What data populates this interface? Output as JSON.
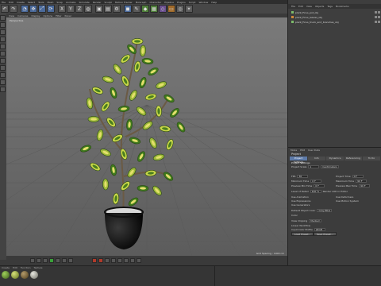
{
  "menubar": {
    "items": [
      "File",
      "Edit",
      "Create",
      "Select",
      "Tools",
      "Mesh",
      "Snap",
      "Animate",
      "Simulate",
      "Render",
      "Sculpt",
      "Motion Tracker",
      "MoGraph",
      "Character",
      "Pipeline",
      "Plugins",
      "Script",
      "Window",
      "Help"
    ]
  },
  "toolbar": {
    "icons": [
      "undo-icon",
      "redo-icon",
      "live-selection-icon",
      "move-icon",
      "scale-icon",
      "rotate-icon",
      "x-axis-icon",
      "y-axis-icon",
      "z-axis-icon",
      "world-coords-icon",
      "render-view-icon",
      "render-pv-icon",
      "render-settings-icon",
      "cube-icon",
      "pen-icon",
      "subdivision-icon",
      "array-icon",
      "cloner-icon",
      "deformer-icon",
      "floor-icon",
      "camera-icon",
      "light-icon"
    ]
  },
  "viewport": {
    "menu": [
      "View",
      "Cameras",
      "Display",
      "Options",
      "Filter",
      "Panel"
    ],
    "label": "Perspective",
    "status": "Grid Spacing : 1000 cm"
  },
  "object_manager": {
    "menu": [
      "File",
      "Edit",
      "View",
      "Objects",
      "Tags",
      "Bookmarks"
    ],
    "rows": [
      {
        "name": "plant_Ficus_pot_obj",
        "color": "#7dbb6a"
      },
      {
        "name": "plant_Ficus_leaves_obj",
        "color": "#d08a3a"
      },
      {
        "name": "plant_Ficus_trunk_and_branches_obj",
        "color": "#7dbb6a"
      }
    ]
  },
  "attribute_manager": {
    "menu": [
      "Mode",
      "Edit",
      "User Data"
    ],
    "title": "Project",
    "tabs": [
      "Project Settings",
      "Info",
      "Dynamics",
      "Referencing",
      "To Do"
    ],
    "active_tab": "Project Settings",
    "section": "Project Settings",
    "fields": [
      {
        "label": "Project Scale",
        "value": "1",
        "unit": "Centimeters"
      },
      {
        "label": "FPS",
        "value": "30"
      },
      {
        "label": "Minimum Time",
        "value": "0 F"
      },
      {
        "label": "Preview Min Time",
        "value": "0 F"
      },
      {
        "label": "Project Time",
        "value": "0 F"
      },
      {
        "label": "Maximum Time",
        "value": "90 F"
      },
      {
        "label": "Preview Max Time",
        "value": "90 F"
      },
      {
        "label": "Level of Detail",
        "value": "100 %"
      },
      {
        "label": "Render LOD in Editor",
        "value": ""
      },
      {
        "label": "Use Animation",
        "value": ""
      },
      {
        "label": "Use Expressions",
        "value": ""
      },
      {
        "label": "Use Generators",
        "value": ""
      },
      {
        "label": "Use Deformers",
        "value": ""
      },
      {
        "label": "Use Motion System",
        "value": ""
      },
      {
        "label": "Default Object Color",
        "value": "Gray-Blue"
      },
      {
        "label": "Color",
        "value": ""
      },
      {
        "label": "View Clipping",
        "value": "Medium"
      },
      {
        "label": "Linear Workflow",
        "value": ""
      },
      {
        "label": "Input Color Profile",
        "value": "sRGB"
      }
    ],
    "buttons": [
      "Load Preset...",
      "Save Preset..."
    ]
  },
  "timeline": {
    "start": "0 F",
    "end": "90 F",
    "current": "0 F"
  },
  "material_manager": {
    "menu": [
      "Create",
      "Edit",
      "Function",
      "Texture"
    ],
    "materials": [
      {
        "name": "mat_1",
        "color": "#5a8a2a"
      },
      {
        "name": "mat_2",
        "color": "#8aa03a"
      },
      {
        "name": "mat_3",
        "color": "#7a6a4a"
      },
      {
        "name": "mat_4",
        "color": "#b0b0a0"
      }
    ]
  }
}
